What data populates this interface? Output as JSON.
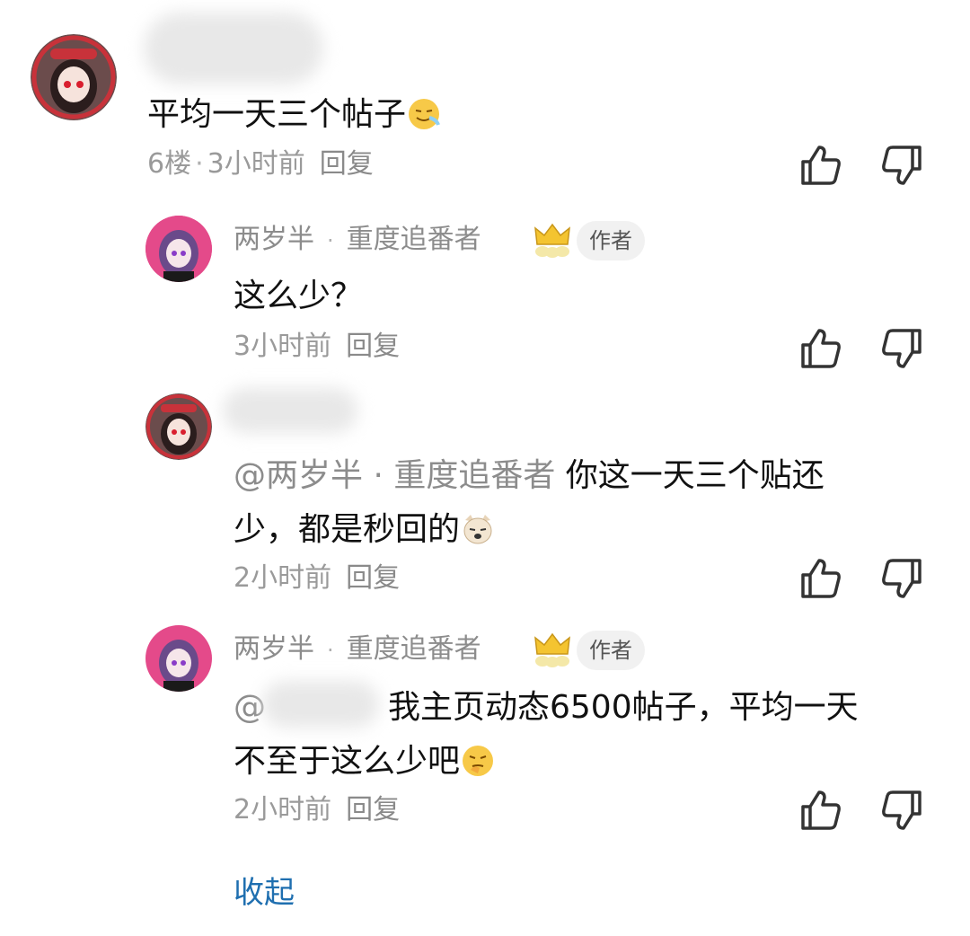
{
  "comments": [
    {
      "id": "c1",
      "text": "平均一天三个帖子",
      "meta": {
        "floor": "6楼",
        "time": "3小时前",
        "reply": "回复"
      }
    },
    {
      "id": "c2",
      "user": {
        "name": "两岁半",
        "title": "重度追番者",
        "badge": "作者"
      },
      "text": "这么少？",
      "meta": {
        "time": "3小时前",
        "reply": "回复"
      }
    },
    {
      "id": "c3",
      "mention": "@两岁半 · 重度追番者",
      "text_line1": "你这一天三个贴还",
      "text_line2": "少，都是秒回的",
      "meta": {
        "time": "2小时前",
        "reply": "回复"
      }
    },
    {
      "id": "c4",
      "user": {
        "name": "两岁半",
        "title": "重度追番者",
        "badge": "作者"
      },
      "mention": "@",
      "text_line1": "我主页动态6500帖子，平均一天",
      "text_line2": "不至于这么少吧",
      "meta": {
        "time": "2小时前",
        "reply": "回复"
      }
    }
  ],
  "collapse_label": "收起",
  "icons": [
    "thumbs-up-icon",
    "thumbs-down-icon",
    "crown-icon",
    "emoji-icon"
  ],
  "colors": {
    "link": "#1f6fb0",
    "meta": "#9a9a9a",
    "badge_bg": "#f1f1f1"
  }
}
